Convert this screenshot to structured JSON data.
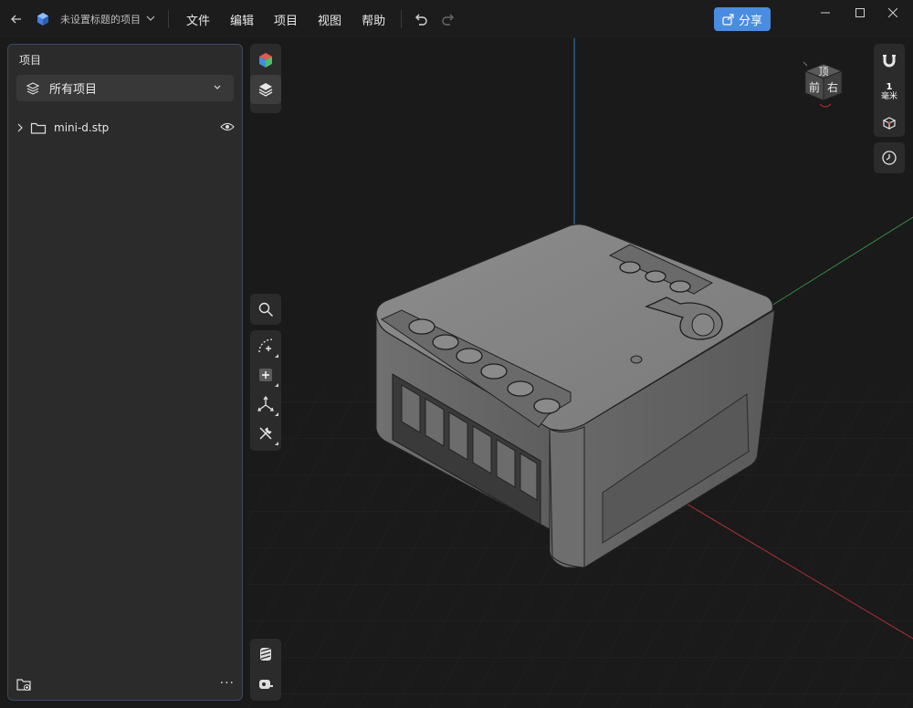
{
  "titlebar": {
    "project_title": "未设置标题的项目",
    "menu": [
      "文件",
      "编辑",
      "项目",
      "视图",
      "帮助"
    ],
    "share_label": "分享"
  },
  "panel": {
    "title": "项目",
    "filter_label": "所有项目",
    "tree": [
      {
        "label": "mini-d.stp",
        "type": "folder",
        "expanded": false,
        "visible": true
      }
    ],
    "more_label": "···"
  },
  "view_cube": {
    "top_label": "顶",
    "front_label": "前",
    "right_label": "右"
  },
  "scale": {
    "value": "1",
    "unit": "毫米"
  },
  "colors": {
    "accent": "#4a8de0",
    "background": "#1a1a1a",
    "panel": "#2b2b2b"
  }
}
